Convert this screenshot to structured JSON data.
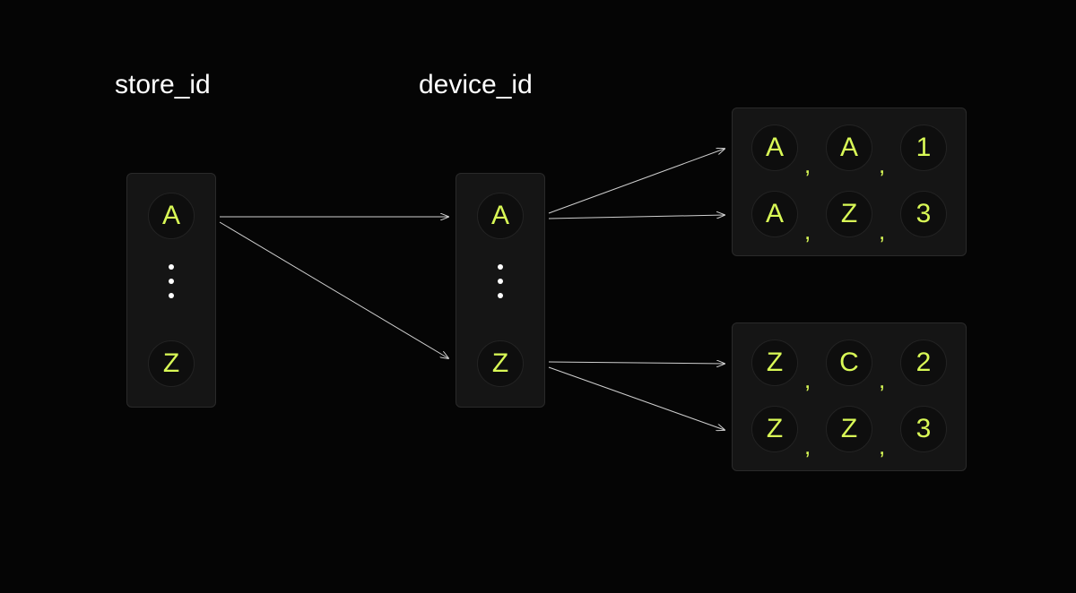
{
  "labels": {
    "store_id": "store_id",
    "device_id": "device_id"
  },
  "column_store": {
    "top": "A",
    "bottom": "Z"
  },
  "column_device": {
    "top": "A",
    "bottom": "Z"
  },
  "result_top": {
    "row1": [
      "A",
      "A",
      "1"
    ],
    "row2": [
      "A",
      "Z",
      "3"
    ]
  },
  "result_bottom": {
    "row1": [
      "Z",
      "C",
      "2"
    ],
    "row2": [
      "Z",
      "Z",
      "3"
    ]
  },
  "colors": {
    "bg": "#050505",
    "panel": "#151515",
    "node": "#0e0e0e",
    "accent": "#d9f956",
    "text": "#ffffff",
    "line": "#cfcfcf"
  }
}
